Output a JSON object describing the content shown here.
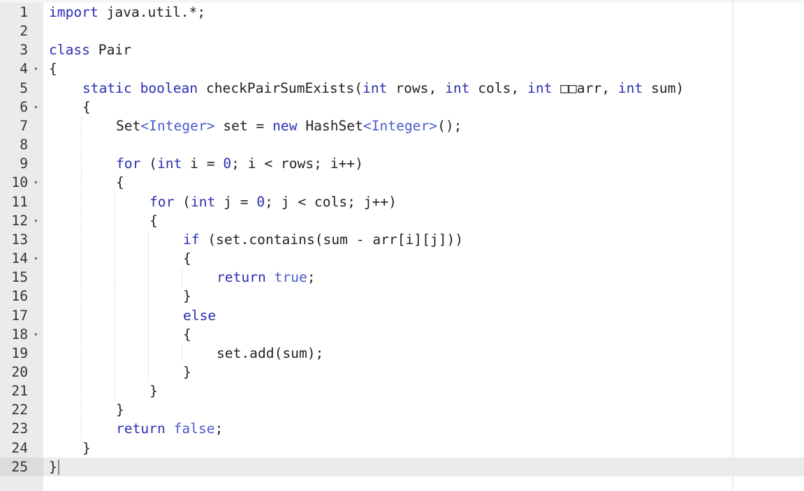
{
  "editor": {
    "language": "java",
    "active_line": 25,
    "lines": [
      {
        "n": "1",
        "fold": false,
        "indent": 0,
        "tokens": [
          {
            "t": "import",
            "c": "kw"
          },
          {
            "t": " java.util.*;",
            "c": ""
          }
        ]
      },
      {
        "n": "2",
        "fold": false,
        "indent": 0,
        "tokens": []
      },
      {
        "n": "3",
        "fold": false,
        "indent": 0,
        "tokens": [
          {
            "t": "class",
            "c": "kw"
          },
          {
            "t": " Pair",
            "c": ""
          }
        ]
      },
      {
        "n": "4",
        "fold": true,
        "indent": 0,
        "tokens": [
          {
            "t": "{",
            "c": ""
          }
        ]
      },
      {
        "n": "5",
        "fold": false,
        "indent": 1,
        "tokens": [
          {
            "t": "static",
            "c": "kw"
          },
          {
            "t": " ",
            "c": ""
          },
          {
            "t": "boolean",
            "c": "kw"
          },
          {
            "t": " checkPairSumExists(",
            "c": ""
          },
          {
            "t": "int",
            "c": "kw"
          },
          {
            "t": " rows, ",
            "c": ""
          },
          {
            "t": "int",
            "c": "kw"
          },
          {
            "t": " cols, ",
            "c": ""
          },
          {
            "t": "int",
            "c": "kw"
          },
          {
            "t": " □□arr, ",
            "c": ""
          },
          {
            "t": "int",
            "c": "kw"
          },
          {
            "t": " sum)",
            "c": ""
          }
        ]
      },
      {
        "n": "6",
        "fold": true,
        "indent": 1,
        "tokens": [
          {
            "t": "{",
            "c": ""
          }
        ]
      },
      {
        "n": "7",
        "fold": false,
        "indent": 2,
        "tokens": [
          {
            "t": "Set",
            "c": ""
          },
          {
            "t": "<Integer>",
            "c": "ty"
          },
          {
            "t": " set = ",
            "c": ""
          },
          {
            "t": "new",
            "c": "kw"
          },
          {
            "t": " HashSet",
            "c": ""
          },
          {
            "t": "<Integer>",
            "c": "ty"
          },
          {
            "t": "();",
            "c": ""
          }
        ]
      },
      {
        "n": "8",
        "fold": false,
        "indent": 2,
        "tokens": []
      },
      {
        "n": "9",
        "fold": false,
        "indent": 2,
        "tokens": [
          {
            "t": "for",
            "c": "kw"
          },
          {
            "t": " (",
            "c": ""
          },
          {
            "t": "int",
            "c": "kw"
          },
          {
            "t": " i = ",
            "c": ""
          },
          {
            "t": "0",
            "c": "nm"
          },
          {
            "t": "; i < rows; i++)",
            "c": ""
          }
        ]
      },
      {
        "n": "10",
        "fold": true,
        "indent": 2,
        "tokens": [
          {
            "t": "{",
            "c": ""
          }
        ]
      },
      {
        "n": "11",
        "fold": false,
        "indent": 3,
        "tokens": [
          {
            "t": "for",
            "c": "kw"
          },
          {
            "t": " (",
            "c": ""
          },
          {
            "t": "int",
            "c": "kw"
          },
          {
            "t": " j = ",
            "c": ""
          },
          {
            "t": "0",
            "c": "nm"
          },
          {
            "t": "; j < cols; j++)",
            "c": ""
          }
        ]
      },
      {
        "n": "12",
        "fold": true,
        "indent": 3,
        "tokens": [
          {
            "t": "{",
            "c": ""
          }
        ]
      },
      {
        "n": "13",
        "fold": false,
        "indent": 4,
        "tokens": [
          {
            "t": "if",
            "c": "kw"
          },
          {
            "t": " (set.contains(sum - arr[i][j]))",
            "c": ""
          }
        ]
      },
      {
        "n": "14",
        "fold": true,
        "indent": 4,
        "tokens": [
          {
            "t": "{",
            "c": ""
          }
        ]
      },
      {
        "n": "15",
        "fold": false,
        "indent": 5,
        "tokens": [
          {
            "t": "return",
            "c": "kw"
          },
          {
            "t": " ",
            "c": ""
          },
          {
            "t": "true",
            "c": "ty"
          },
          {
            "t": ";",
            "c": ""
          }
        ]
      },
      {
        "n": "16",
        "fold": false,
        "indent": 4,
        "tokens": [
          {
            "t": "}",
            "c": ""
          }
        ]
      },
      {
        "n": "17",
        "fold": false,
        "indent": 4,
        "tokens": [
          {
            "t": "else",
            "c": "kw"
          }
        ]
      },
      {
        "n": "18",
        "fold": true,
        "indent": 4,
        "tokens": [
          {
            "t": "{",
            "c": ""
          }
        ]
      },
      {
        "n": "19",
        "fold": false,
        "indent": 5,
        "tokens": [
          {
            "t": "set.add(sum);",
            "c": ""
          }
        ]
      },
      {
        "n": "20",
        "fold": false,
        "indent": 4,
        "tokens": [
          {
            "t": "}",
            "c": ""
          }
        ]
      },
      {
        "n": "21",
        "fold": false,
        "indent": 3,
        "tokens": [
          {
            "t": "}",
            "c": ""
          }
        ]
      },
      {
        "n": "22",
        "fold": false,
        "indent": 2,
        "tokens": [
          {
            "t": "}",
            "c": ""
          }
        ]
      },
      {
        "n": "23",
        "fold": false,
        "indent": 2,
        "tokens": [
          {
            "t": "return",
            "c": "kw"
          },
          {
            "t": " ",
            "c": ""
          },
          {
            "t": "false",
            "c": "ty"
          },
          {
            "t": ";",
            "c": ""
          }
        ]
      },
      {
        "n": "24",
        "fold": false,
        "indent": 1,
        "tokens": [
          {
            "t": "}",
            "c": ""
          }
        ]
      },
      {
        "n": "25",
        "fold": false,
        "indent": 0,
        "tokens": [
          {
            "t": "}",
            "c": ""
          }
        ]
      }
    ],
    "fold_icon": "▾",
    "colors": {
      "keyword": "#2a2fb2",
      "type": "#4a5bc8",
      "text": "#222222",
      "gutter_bg": "#ebebeb",
      "active_line_bg": "#ebebeb"
    }
  }
}
